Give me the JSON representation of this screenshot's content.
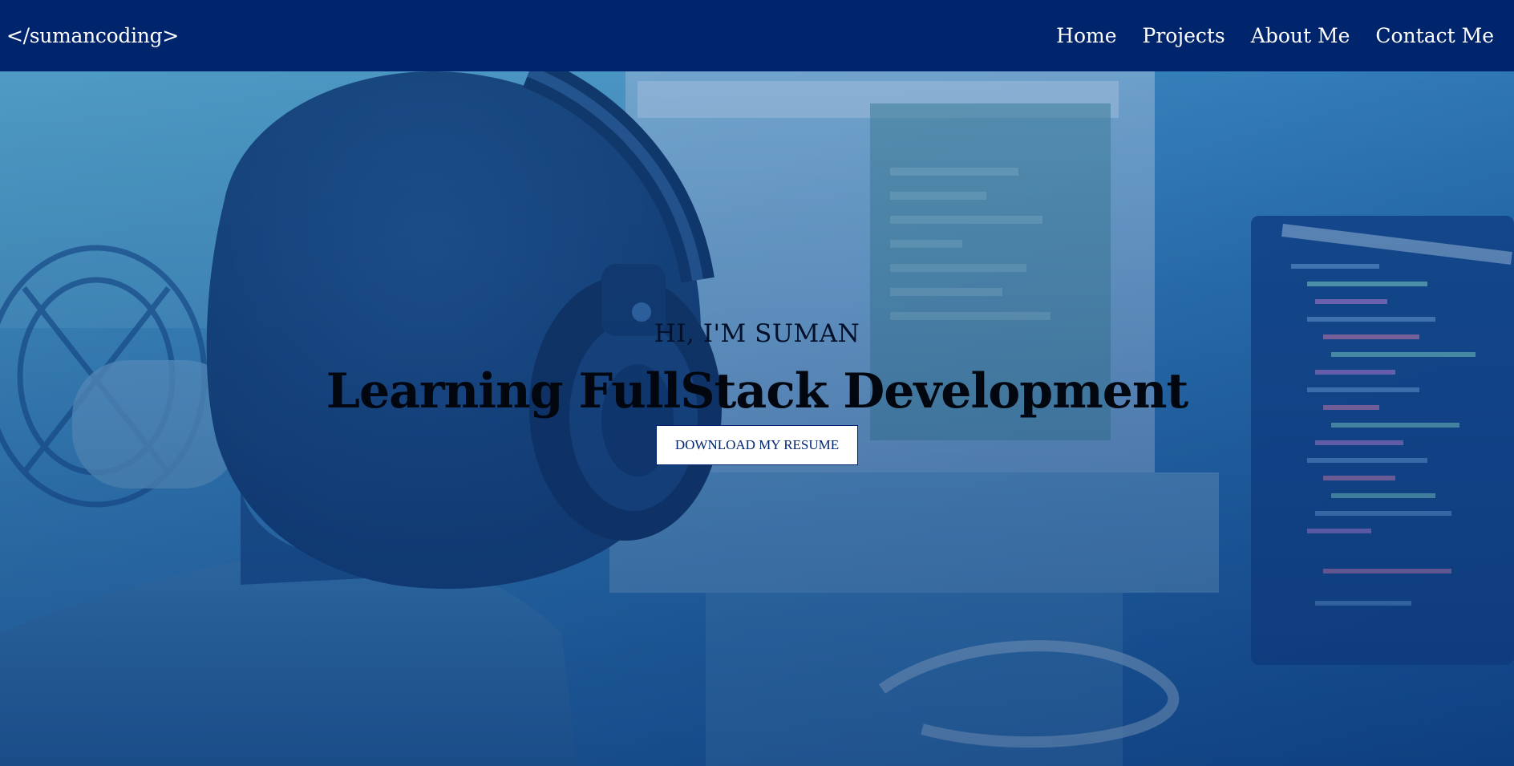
{
  "navbar": {
    "brand": "</sumancoding>",
    "links": [
      {
        "label": "Home"
      },
      {
        "label": "Projects"
      },
      {
        "label": "About Me"
      },
      {
        "label": "Contact Me"
      }
    ]
  },
  "hero": {
    "kicker": "HI, I'M SUMAN",
    "title": "Learning FullStack Development",
    "button_label": "DOWNLOAD MY RESUME"
  },
  "colors": {
    "navbar_bg": "#00256d",
    "overlay_blue": "#1e5fa8",
    "button_text": "#00256d"
  }
}
